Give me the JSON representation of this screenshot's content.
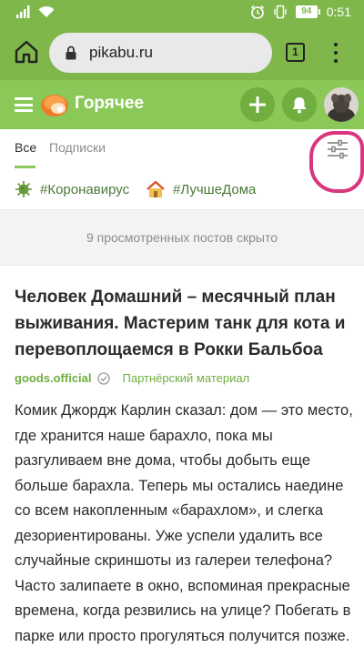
{
  "status_bar": {
    "battery": "94",
    "time": "0:51",
    "colors": {
      "background": "#7fb74a"
    }
  },
  "browser": {
    "url": "pikabu.ru",
    "tab_count": "1"
  },
  "header": {
    "title": "Горячее",
    "colors": {
      "background": "#8ac858",
      "button": "#6fae3f"
    }
  },
  "tabs": {
    "all": "Все",
    "subscriptions": "Подписки"
  },
  "tags": [
    {
      "label": "#Коронавирус",
      "icon": "virus-icon"
    },
    {
      "label": "#ЛучшеДома",
      "icon": "house-icon"
    }
  ],
  "hidden_notice": "9 просмотренных постов скрыто",
  "post": {
    "title": "Человек Домашний – месячный план выживания. Мастерим танк для кота и перевоплощаемся в Рокки Бальбоа",
    "author": "goods.official",
    "partner_label": "Партнёрский материал",
    "body": "Комик Джордж Карлин сказал: дом — это место, где хранится наше барахло, пока мы разгуливаем вне дома, чтобы добыть еще больше барахла. Теперь мы остались наедине со всем накопленным «барахлом», и слегка дезориентированы. Уже успели удалить все случайные скриншоты из галереи телефона? Часто залипаете в окно, вспоминая прекрасные времена, когда резвились на улице? Побегать в парке или просто прогуляться получится позже. А пока"
  },
  "accent_colors": {
    "link": "#6fae3f",
    "highlight_ring": "#d8367d"
  }
}
